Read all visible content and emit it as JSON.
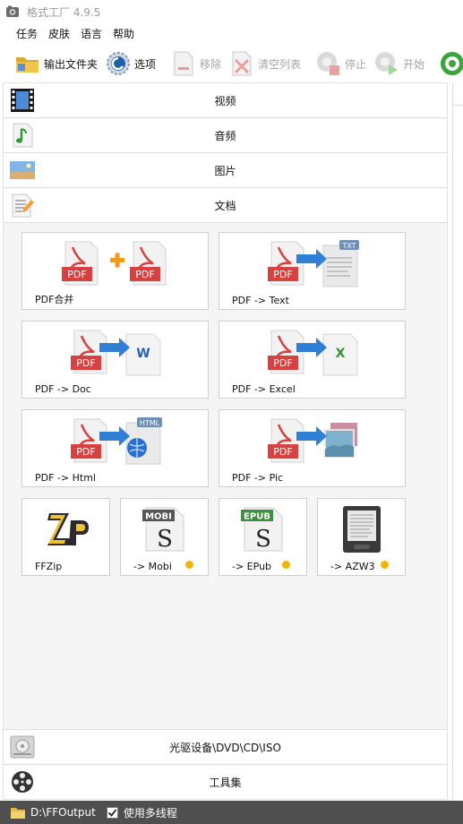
{
  "window": {
    "title": "格式工厂 4.9.5",
    "icon": "app-logo-icon"
  },
  "menu": {
    "items": [
      "任务",
      "皮肤",
      "语言",
      "帮助"
    ]
  },
  "toolbar": {
    "output_folder": {
      "label": "输出文件夹",
      "icon": "folder-icon"
    },
    "options": {
      "label": "选项",
      "icon": "options-gear-icon"
    },
    "remove": {
      "label": "移除",
      "icon": "remove-file-icon"
    },
    "clear_list": {
      "label": "清空列表",
      "icon": "clear-list-icon"
    },
    "stop": {
      "label": "停止",
      "icon": "stop-icon"
    },
    "start": {
      "label": "开始",
      "icon": "start-icon"
    },
    "extra": {
      "icon": "web-globe-icon"
    }
  },
  "categories": {
    "video": {
      "label": "视频",
      "icon": "film-strip-icon"
    },
    "audio": {
      "label": "音频",
      "icon": "music-note-icon"
    },
    "image": {
      "label": "图片",
      "icon": "landscape-image-icon"
    },
    "document": {
      "label": "文档",
      "icon": "document-pen-icon"
    },
    "optical": {
      "label": "光驱设备\\DVD\\CD\\ISO",
      "icon": "optical-drive-icon"
    },
    "tools": {
      "label": "工具集",
      "icon": "film-reel-icon"
    }
  },
  "document_tools": [
    {
      "label": "PDF合并",
      "icon": "pdf-merge-icon",
      "pro": false
    },
    {
      "label": "PDF -> Text",
      "icon": "pdf-to-text-icon",
      "pro": false
    },
    {
      "label": "PDF -> Doc",
      "icon": "pdf-to-doc-icon",
      "pro": false
    },
    {
      "label": "PDF -> Excel",
      "icon": "pdf-to-excel-icon",
      "pro": false
    },
    {
      "label": "PDF -> Html",
      "icon": "pdf-to-html-icon",
      "pro": false
    },
    {
      "label": "PDF -> Pic",
      "icon": "pdf-to-pic-icon",
      "pro": false
    },
    {
      "label": "FFZip",
      "icon": "ffzip-icon",
      "pro": false
    },
    {
      "label": "-> Mobi",
      "icon": "mobi-file-icon",
      "pro": true
    },
    {
      "label": "-> EPub",
      "icon": "epub-file-icon",
      "pro": true
    },
    {
      "label": "-> AZW3",
      "icon": "ereader-icon",
      "pro": true
    }
  ],
  "icon_text": {
    "pdf": "PDF",
    "txt": "TXT",
    "w": "W",
    "x": "X",
    "html": "HTML",
    "mobi": "MOBI",
    "epub": "EPUB",
    "s": "S"
  },
  "statusbar": {
    "output_path": "D:\\FFOutput",
    "multithread_label": "使用多线程",
    "multithread_checked": true
  },
  "colors": {
    "pdf_red": "#d94040",
    "arrow_blue": "#2f7fd6",
    "status_bg": "#4f4f4f",
    "pro_dot": "#f5b400"
  }
}
